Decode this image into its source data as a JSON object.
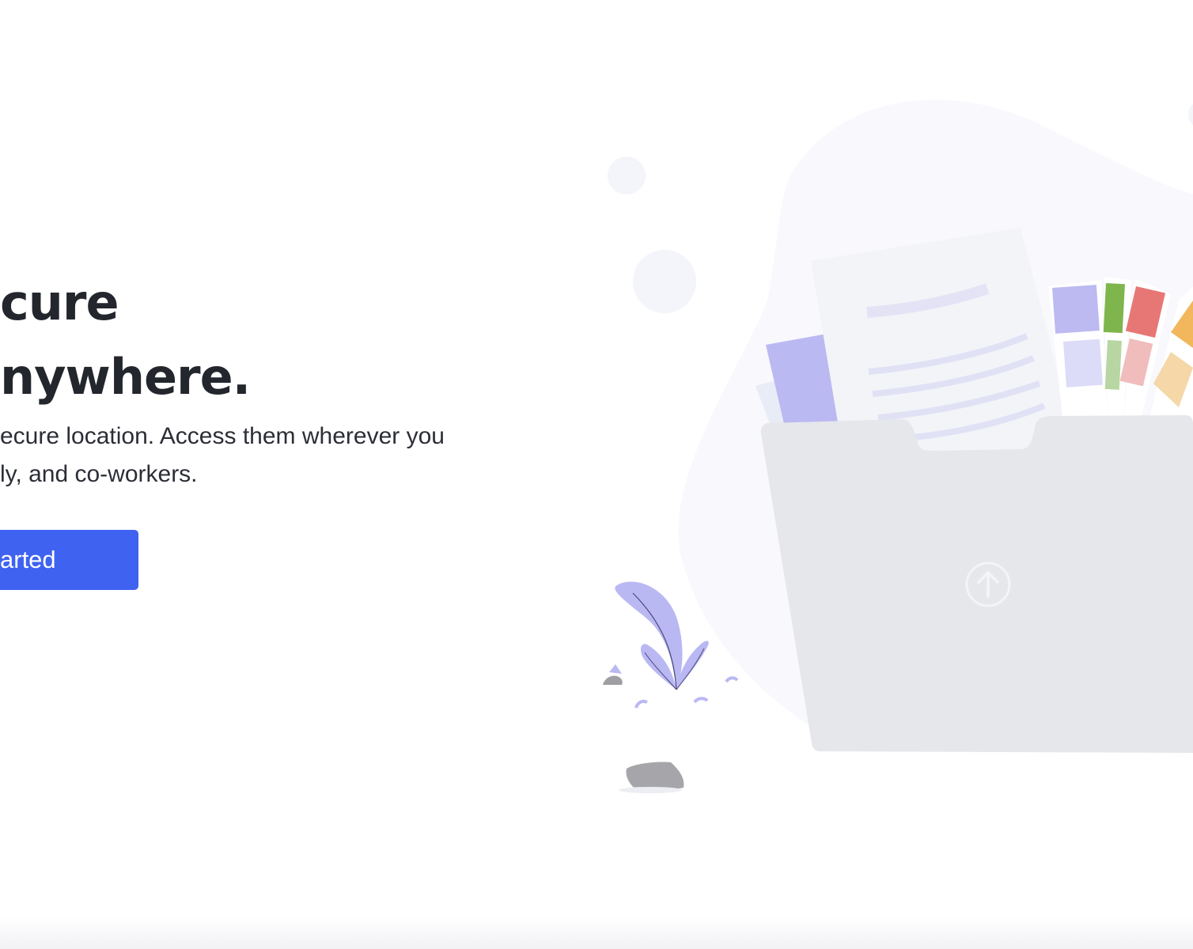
{
  "hero": {
    "title_line1": "cure",
    "title_line2": "nywhere.",
    "description_line1": "ecure location. Access them wherever you",
    "description_line2": "ly, and co-workers.",
    "cta_label": "arted"
  },
  "colors": {
    "accent": "#3f63f0",
    "heading": "#23262d",
    "blob": "#f8f8fd",
    "folder": "#e6e7eb",
    "plant": "#b9b8f2"
  },
  "illustration": {
    "upload_icon": "arrow-up-circle-icon"
  }
}
